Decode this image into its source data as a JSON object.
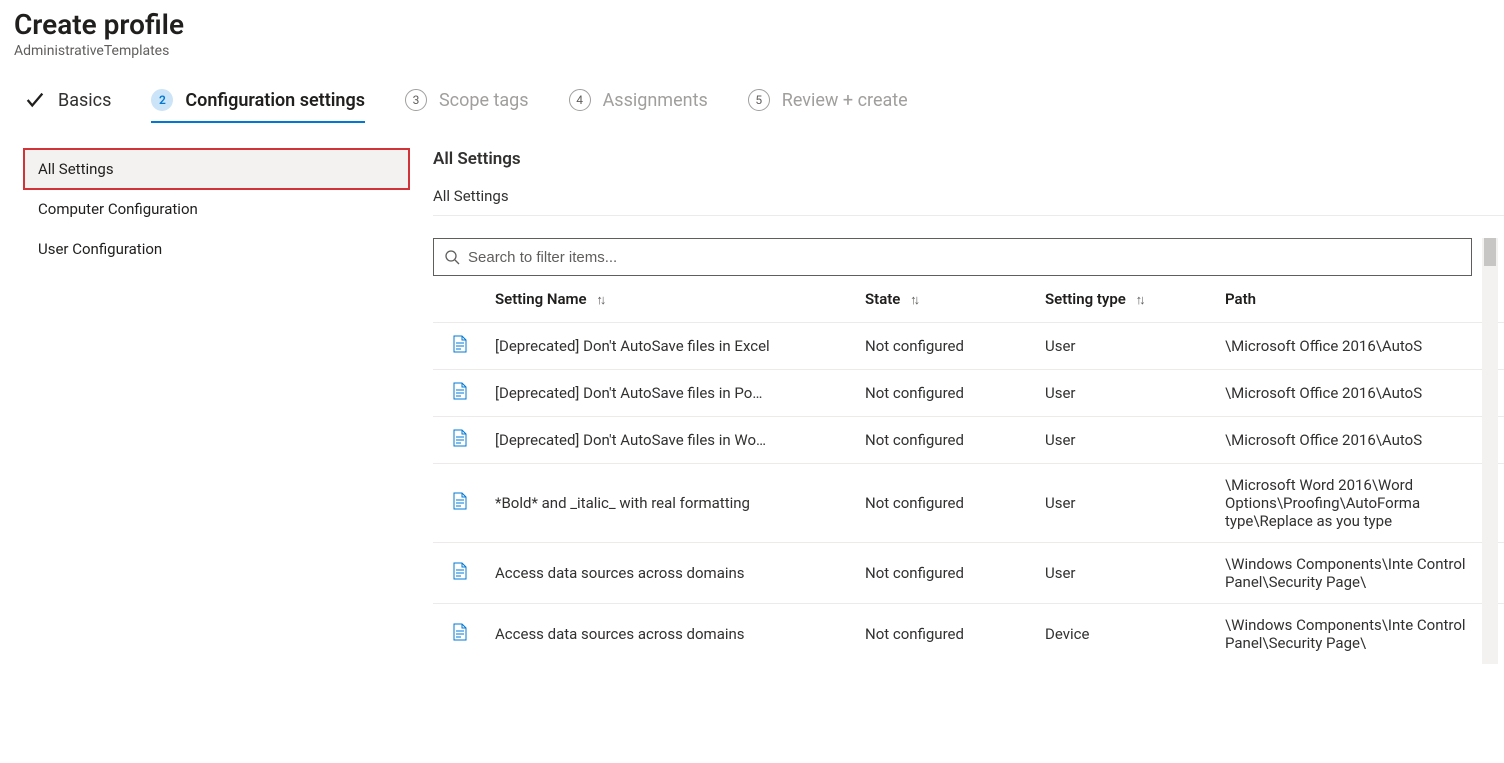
{
  "header": {
    "title": "Create profile",
    "subtitle": "AdministrativeTemplates"
  },
  "wizard": [
    {
      "label": "Basics",
      "state": "done"
    },
    {
      "label": "Configuration settings",
      "state": "active",
      "num": "2"
    },
    {
      "label": "Scope tags",
      "state": "todo",
      "num": "3"
    },
    {
      "label": "Assignments",
      "state": "todo",
      "num": "4"
    },
    {
      "label": "Review + create",
      "state": "todo",
      "num": "5"
    }
  ],
  "sidebar": {
    "items": [
      {
        "label": "All Settings",
        "active": true,
        "highlight": true
      },
      {
        "label": "Computer Configuration",
        "active": false,
        "highlight": false
      },
      {
        "label": "User Configuration",
        "active": false,
        "highlight": false
      }
    ]
  },
  "main": {
    "title": "All Settings",
    "breadcrumb": "All Settings",
    "search_placeholder": "Search to filter items...",
    "columns": {
      "name": "Setting Name",
      "state": "State",
      "type": "Setting type",
      "path": "Path"
    },
    "rows": [
      {
        "name": "[Deprecated] Don't AutoSave files in Excel",
        "name_display": "[Deprecated] Don't AutoSave files in Excel",
        "state": "Not configured",
        "type": "User",
        "path": "\\Microsoft Office 2016\\AutoS",
        "multiline": false
      },
      {
        "name": "[Deprecated] Don't AutoSave files in PowerPoint",
        "name_display": "[Deprecated] Don't AutoSave files in Po…",
        "state": "Not configured",
        "type": "User",
        "path": "\\Microsoft Office 2016\\AutoS",
        "multiline": false
      },
      {
        "name": "[Deprecated] Don't AutoSave files in Word",
        "name_display": "[Deprecated] Don't AutoSave files in Wo…",
        "state": "Not configured",
        "type": "User",
        "path": "\\Microsoft Office 2016\\AutoS",
        "multiline": false
      },
      {
        "name": "*Bold* and _italic_ with real formatting",
        "name_display": "*Bold* and _italic_ with real formatting",
        "state": "Not configured",
        "type": "User",
        "path": "\\Microsoft Word 2016\\Word Options\\Proofing\\AutoForma type\\Replace as you type",
        "multiline": true
      },
      {
        "name": "Access data sources across domains",
        "name_display": "Access data sources across domains",
        "state": "Not configured",
        "type": "User",
        "path": "\\Windows Components\\Inte Control Panel\\Security Page\\",
        "multiline": true
      },
      {
        "name": "Access data sources across domains",
        "name_display": "Access data sources across domains",
        "state": "Not configured",
        "type": "Device",
        "path": "\\Windows Components\\Inte Control Panel\\Security Page\\",
        "multiline": true
      }
    ]
  }
}
